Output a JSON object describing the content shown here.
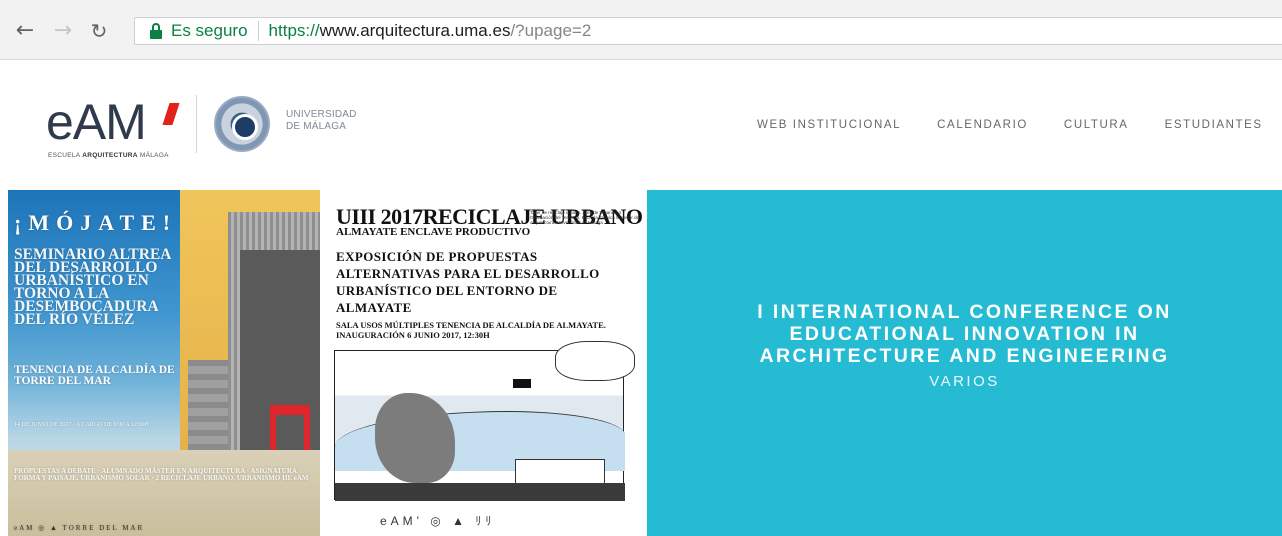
{
  "browser": {
    "back_icon": "arrow-left-icon",
    "forward_icon": "arrow-right-icon",
    "reload_icon": "reload-icon",
    "security_label": "Es seguro",
    "url_scheme": "https://",
    "url_host": "www.arquitectura.uma.es",
    "url_path": "/?upage=2"
  },
  "header": {
    "logo_text": "eAM",
    "logo_subtitle_prefix": "ESCUELA ",
    "logo_subtitle_bold": "ARQUITECTURA",
    "logo_subtitle_suffix": " MÁLAGA",
    "university_line1": "UNIVERSIDAD",
    "university_line2": "DE MÁLAGA",
    "accent_color": "#e2231a"
  },
  "nav": {
    "items": [
      "WEB INSTITUCIONAL",
      "CALENDARIO",
      "CULTURA",
      "ESTUDIANTES"
    ]
  },
  "slides": {
    "poster1": {
      "title": "¡MÓJATE!",
      "body": "SEMINARIO ALTREA DEL DESARROLLO URBANÍSTICO EN TORNO A LA DESEMBOCADURA DEL RÍO VÉLEZ",
      "place": "TENENCIA DE ALCALDÍA DE TORRE DEL MAR",
      "details": "14 DE JUNIO DE 2017 · A CARGO DE 9:00 A 12:00H",
      "bottom": "PROPUESTAS A DEBATE · ALUMNADO MÁSTER EN ARQUITECTURA · ASIGNATURA FORMA Y PAISAJE. URBANISMO SOLAR · 2 RECICLAJE URBANO. URBANISMO III. eAM",
      "logos": "eAM  ◎  ▲  TORRE DEL MAR"
    },
    "poster2": {
      "title": "UIII 2017RECICLAJE URBANO",
      "subtitle": "ALMAYATE ENCLAVE PRODUCTIVO",
      "fine_print": "Taller de reciclaje urbano. Área de Urbanismo y Ordenación del Territorio. Escuela Técnica Superior de Arquitectura. Universidad de Málaga",
      "heading": "EXPOSICIÓN DE PROPUESTAS ALTERNATIVAS PARA EL DESARROLLO URBANÍSTICO DEL ENTORNO DE ALMAYATE",
      "venue": "SALA USOS MÚLTIPLES TENENCIA DE ALCALDÍA DE ALMAYATE. INAUGURACIÓN 6 JUNIO 2017, 12:30H",
      "logos": "eAM' ◎ ▲ ﾘﾘ"
    },
    "conference": {
      "title": "I INTERNATIONAL CONFERENCE ON EDUCATIONAL INNOVATION IN ARCHITECTURE AND ENGINEERING",
      "category": "VARIOS",
      "background_color": "#25bbd3"
    }
  }
}
